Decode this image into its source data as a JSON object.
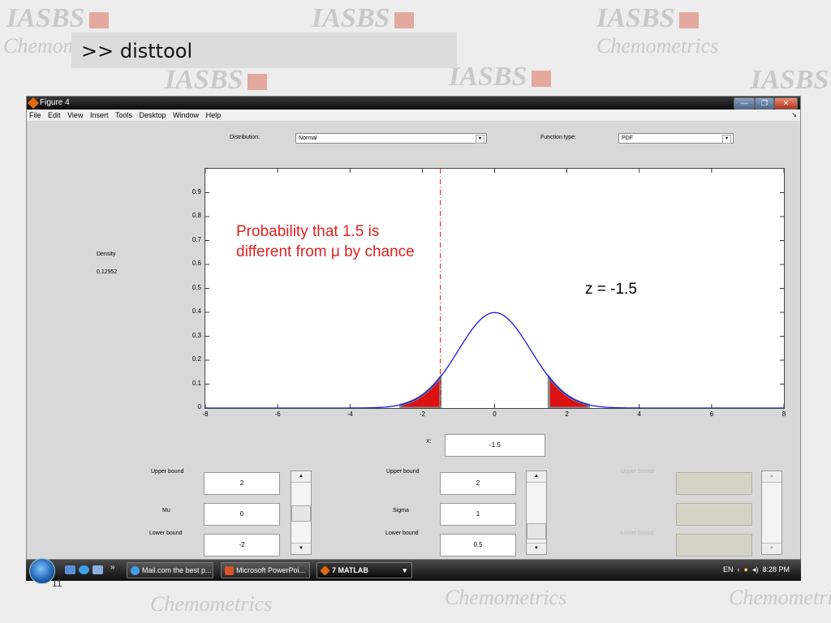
{
  "watermark": {
    "brand": "IASBS",
    "sub": "Chemometrics"
  },
  "command": "&gt;&gt; disttool",
  "window": {
    "title": "Figure 4",
    "controls": {
      "minimize": "—",
      "maximize": "❐",
      "close": "✕"
    },
    "menu": [
      "File",
      "Edit",
      "View",
      "Insert",
      "Tools",
      "Desktop",
      "Window",
      "Help"
    ]
  },
  "distribution": {
    "label": "Distribution:",
    "value": "Normal"
  },
  "function_type": {
    "label": "Function type:",
    "value": "PDF"
  },
  "density": {
    "label": "Density",
    "value": "0.12952"
  },
  "x_input": {
    "label": "X:",
    "value": "-1.5"
  },
  "param1": {
    "upper_label": "Upper bound",
    "upper": "2",
    "name": "Mu",
    "value": "0",
    "lower_label": "Lower bound",
    "lower": "-2"
  },
  "param2": {
    "upper_label": "Upper bound",
    "upper": "2",
    "name": "Sigma",
    "value": "1",
    "lower_label": "Lower bound",
    "lower": "0.5"
  },
  "param3": {
    "upper_label": "Upper bound",
    "lower_label": "Lower bound"
  },
  "annotation": {
    "line1": "Probability that 1.5 is",
    "line2": "different from μ by chance"
  },
  "z_label": "z = -1.5",
  "chart_data": {
    "type": "line",
    "title": "",
    "xlabel": "",
    "ylabel": "",
    "xlim": [
      -8,
      8
    ],
    "ylim": [
      0,
      1
    ],
    "xticks": [
      -8,
      -6,
      -4,
      -2,
      0,
      2,
      4,
      6,
      8
    ],
    "yticks": [
      0,
      0.1,
      0.2,
      0.3,
      0.4,
      0.5,
      0.6,
      0.7,
      0.8,
      0.9
    ],
    "series": [
      {
        "function": "normal_pdf",
        "mu": 0,
        "sigma": 1
      }
    ],
    "marker_x": -1.5,
    "shaded_tails": [
      [
        -2.6,
        -1.5
      ],
      [
        1.5,
        2.6
      ]
    ],
    "colors": {
      "curve": "#1a1ae0",
      "shade": "#dd1111",
      "shade_edge": "#8a8a8a",
      "marker": "#dd1111"
    }
  },
  "taskbar": {
    "tasks": [
      {
        "label": "Mail.com the best p..."
      },
      {
        "label": "Microsoft PowerPoi..."
      },
      {
        "label": "7 MATLAB"
      }
    ],
    "lang": "EN",
    "time": "8:28 PM",
    "chevron": "»",
    "dropdown": "▾"
  },
  "slide_number": "11"
}
